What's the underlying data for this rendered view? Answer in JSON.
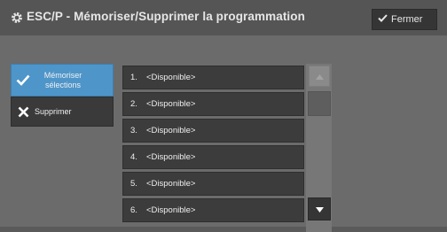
{
  "header": {
    "title": "ESC/P - Mémoriser/Supprimer la programmation",
    "title_icon": "gear-icon",
    "close_label": "Fermer",
    "close_icon": "check-icon"
  },
  "sidebar": {
    "items": [
      {
        "label": "Mémoriser sélections",
        "icon": "check-icon",
        "selected": true
      },
      {
        "label": "Supprimer",
        "icon": "x-icon",
        "selected": false
      }
    ]
  },
  "list": {
    "items": [
      {
        "number": "1.",
        "label": "<Disponible>"
      },
      {
        "number": "2.",
        "label": "<Disponible>"
      },
      {
        "number": "3.",
        "label": "<Disponible>"
      },
      {
        "number": "4.",
        "label": "<Disponible>"
      },
      {
        "number": "5.",
        "label": "<Disponible>"
      },
      {
        "number": "6.",
        "label": "<Disponible>"
      }
    ]
  },
  "scrollbar": {
    "up_icon": "arrow-up-icon",
    "down_icon": "arrow-down-icon"
  },
  "colors": {
    "selected_accent": "#4e95c9",
    "background": "#6b6b6b",
    "titlebar": "#555555"
  }
}
